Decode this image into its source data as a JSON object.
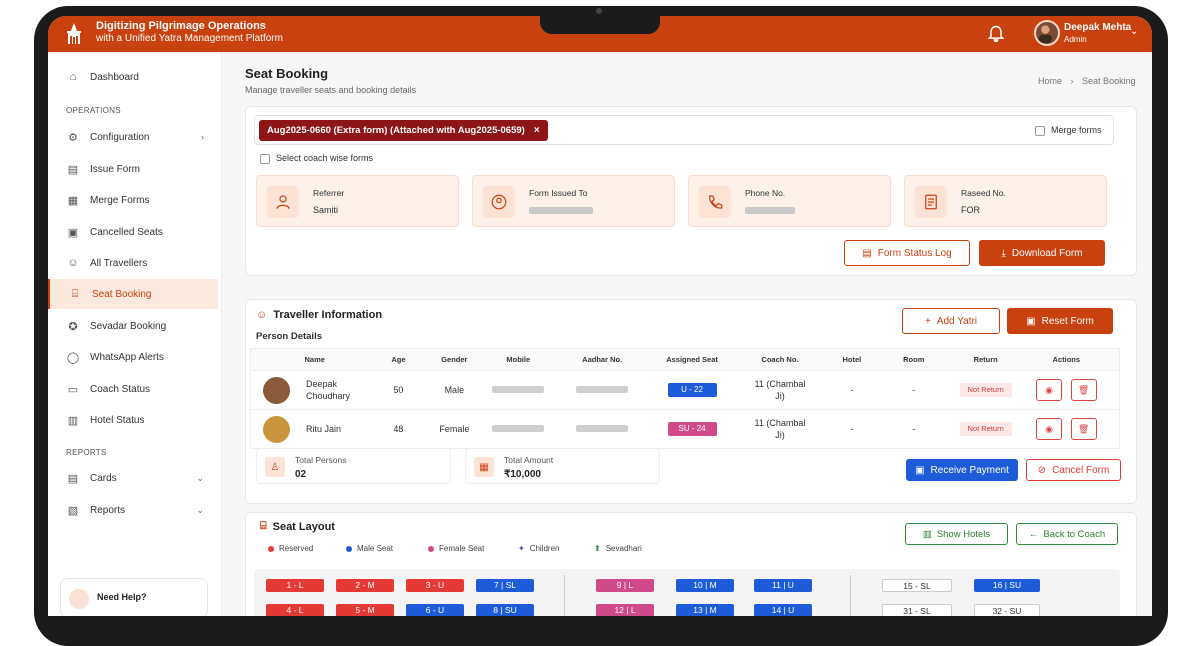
{
  "header": {
    "brand_line1": "Digitizing Pilgrimage Operations",
    "brand_line2": "with a Unified Yatra Management Platform",
    "user_name": "Deepak Mehta",
    "user_role": "Admin"
  },
  "sidebar": {
    "dashboard": "Dashboard",
    "section_operations": "OPERATIONS",
    "items": [
      {
        "label": "Configuration"
      },
      {
        "label": "Issue Form"
      },
      {
        "label": "Merge Forms"
      },
      {
        "label": "Cancelled Seats"
      },
      {
        "label": "All Travellers"
      },
      {
        "label": "Seat Booking"
      },
      {
        "label": "Sevadar Booking"
      },
      {
        "label": "WhatsApp Alerts"
      },
      {
        "label": "Coach Status"
      },
      {
        "label": "Hotel Status"
      }
    ],
    "section_reports": "REPORTS",
    "cards": "Cards",
    "reports": "Reports",
    "help": "Need Help?"
  },
  "page": {
    "title": "Seat Booking",
    "subtitle": "Manage traveller seats and booking details",
    "crumb_home": "Home",
    "crumb_current": "Seat Booking"
  },
  "form": {
    "chip": "Aug2025-0660 (Extra form) (Attached with Aug2025-0659)",
    "chip_close": "×",
    "merge_label": "Merge forms",
    "coach_wise_label": "Select coach wise forms",
    "referrer_label": "Referrer",
    "referrer_value": "Samiti",
    "issued_label": "Form Issued To",
    "phone_label": "Phone No.",
    "raseed_label": "Raseed No.",
    "raseed_value": "FOR",
    "status_log": "Form Status Log",
    "download": "Download Form"
  },
  "traveller": {
    "title": "Traveller Information",
    "add_yatri": "Add Yatri",
    "reset_form": "Reset Form",
    "person_details": "Person Details",
    "columns": [
      "Name",
      "Age",
      "Gender",
      "Mobile",
      "Aadhar No.",
      "Assigned Seat",
      "Coach No.",
      "Hotel",
      "Room",
      "Return",
      "Actions"
    ],
    "rows": [
      {
        "name": "Deepak Choudhary",
        "age": "50",
        "gender": "Male",
        "seat": "U - 22",
        "coach": "11 (Chambal Ji)",
        "hotel": "-",
        "room": "-",
        "return": "Not Return"
      },
      {
        "name": "Ritu Jain",
        "age": "48",
        "gender": "Female",
        "seat": "SU - 24",
        "coach": "11 (Chambal Ji)",
        "hotel": "-",
        "room": "-",
        "return": "Not Return"
      }
    ],
    "total_persons_label": "Total Persons",
    "total_persons": "02",
    "total_amount_label": "Total Amount",
    "total_amount": "₹10,000",
    "receive_payment": "Receive Payment",
    "cancel_form": "Cancel Form"
  },
  "seat_layout": {
    "title": "Seat Layout",
    "legend": [
      "Reserved",
      "Male Seat",
      "Female Seat",
      "Children",
      "Sevadhari"
    ],
    "show_hotels": "Show Hotels",
    "back_to_coach": "Back to Coach",
    "row1": [
      "1 - L",
      "2 - M",
      "3 - U",
      "7 | SL",
      "9 | L",
      "10 | M",
      "11 | U",
      "15 - SL",
      "16 | SU"
    ],
    "row2": [
      "4 - L",
      "5 - M",
      "6 - U",
      "8 | SU",
      "12 | L",
      "13 | M",
      "14 | U",
      "31 - SL",
      "32 - SU"
    ]
  },
  "colors": {
    "brand": "#c8410f",
    "reserved": "#e53935",
    "male": "#1e5bd8",
    "female": "#d04a8a"
  }
}
